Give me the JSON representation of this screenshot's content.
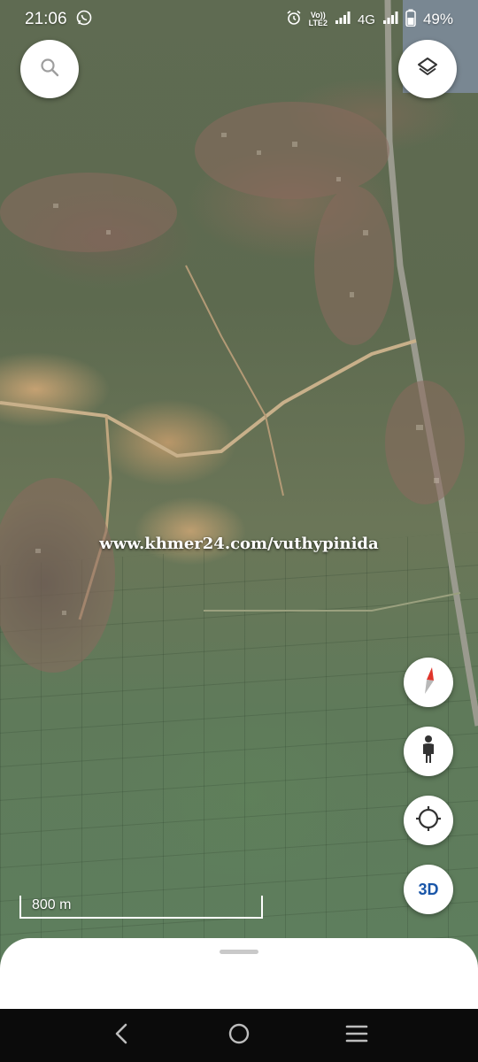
{
  "status_bar": {
    "time": "21:06",
    "network_tag_top": "Vo))",
    "network_tag_bottom": "LTE2",
    "network_type": "4G",
    "battery": "49%",
    "icons": [
      "whatsapp-icon",
      "alarm-icon",
      "signal-icon",
      "signal-icon",
      "battery-icon"
    ]
  },
  "map": {
    "type": "satellite",
    "watermark": "www.khmer24.com/vuthypinida",
    "scale_label": "800 m"
  },
  "controls": {
    "search": "search-icon",
    "layers": "layers-icon",
    "compass": "compass-icon",
    "street_view": "pegman-icon",
    "my_location": "crosshair-icon",
    "three_d_label": "3D"
  },
  "navigation": [
    "back-icon",
    "home-icon",
    "recents-icon"
  ],
  "colors": {
    "compass_red": "#e0352b",
    "three_d_blue": "#1a56a8",
    "nav_bar": "#0b0b0b"
  }
}
